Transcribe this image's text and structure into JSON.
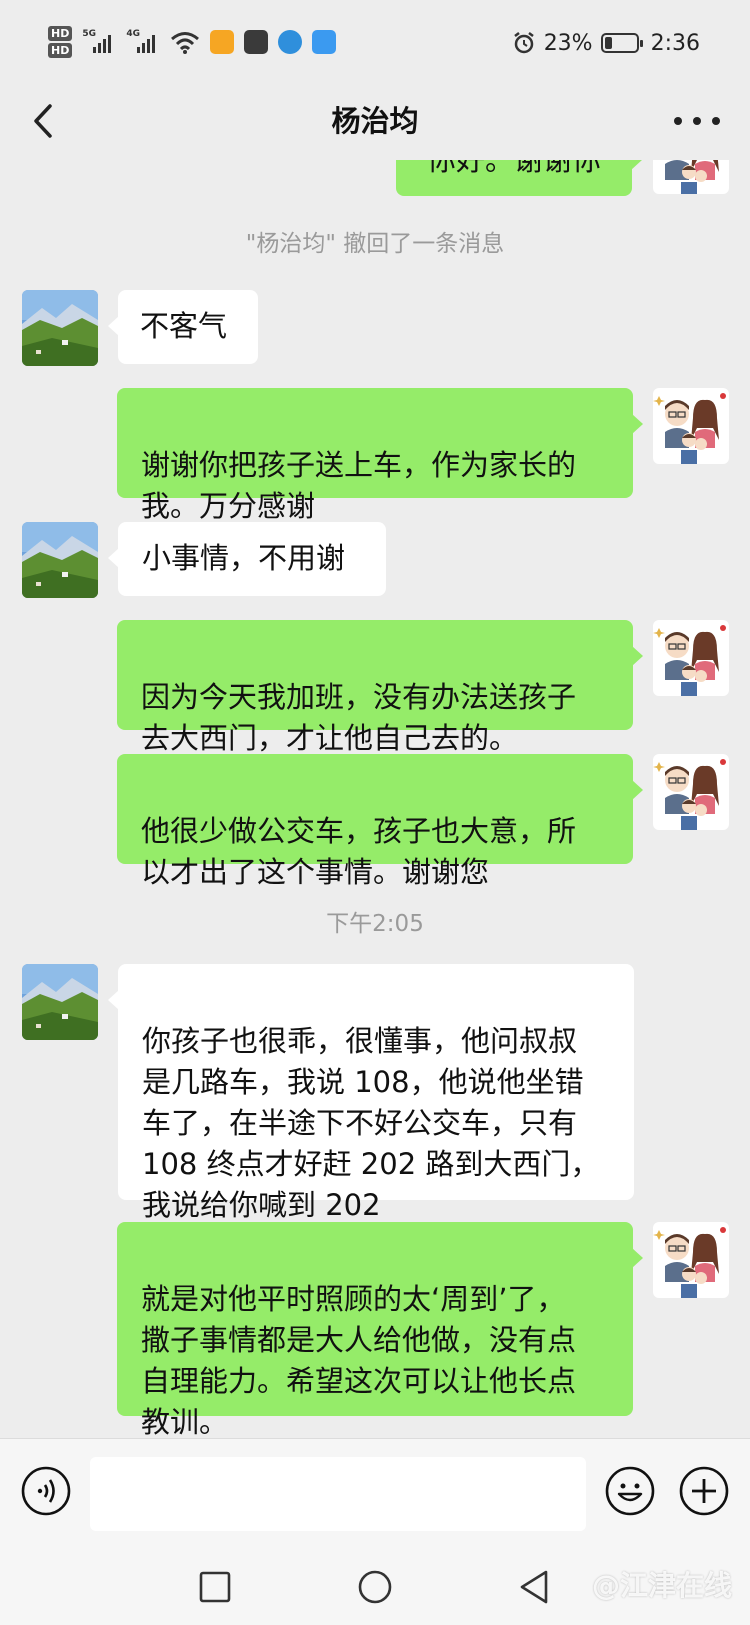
{
  "status_bar": {
    "hd_labels": [
      "HD",
      "HD"
    ],
    "network_1": "5G",
    "network_2": "4G",
    "battery_percent": "23%",
    "battery_level": 0.23,
    "time": "2:36"
  },
  "nav": {
    "title": "杨治均"
  },
  "chat": {
    "partial_top_message": "你好。谢谢你",
    "recall_notice": "\"杨治均\" 撤回了一条消息",
    "messages": [
      {
        "side": "in",
        "text": "不客气"
      },
      {
        "side": "out",
        "text": "谢谢你把孩子送上车，作为家长的\n我。万分感谢"
      },
      {
        "side": "in",
        "text": "小事情，不用谢"
      },
      {
        "side": "out",
        "text": "因为今天我加班，没有办法送孩子\n去大西门，才让他自己去的。"
      },
      {
        "side": "out",
        "text": "他很少做公交车，孩子也大意，所\n以才出了这个事情。谢谢您"
      },
      {
        "side": "in",
        "text": "你孩子也很乖，很懂事，他问叔叔\n是几路车，我说 108，他说他坐错\n车了，在半途下不好公交车，只有\n108 终点才好赶 202 路到大西门，\n我说给你喊到 202"
      },
      {
        "side": "out",
        "text": "就是对他平时照顾的太‘周到’了，\n撒子事情都是大人给他做，没有点\n自理能力。希望这次可以让他长点\n教训。"
      }
    ],
    "timestamp": "下午2:05"
  },
  "input_bar": {
    "text_value": ""
  },
  "watermark": "@江津在线",
  "colors": {
    "background": "#ededed",
    "outgoing_bubble": "#95ec69",
    "incoming_bubble": "#ffffff",
    "system_text": "#9a9a9a"
  },
  "icons": [
    "back-arrow-icon",
    "more-icon",
    "voice-icon",
    "emoji-icon",
    "plus-icon",
    "recent-apps-icon",
    "home-icon",
    "back-triangle-icon",
    "alarm-icon",
    "wifi-icon",
    "battery-icon"
  ]
}
